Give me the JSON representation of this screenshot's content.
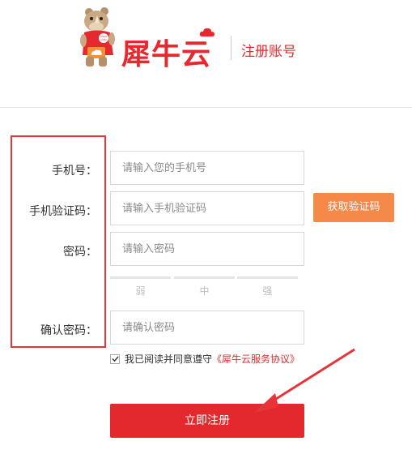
{
  "header": {
    "brand_name": "犀牛云",
    "page_title": "注册账号",
    "mascot_badge_text": "XINIU COM",
    "brand_color": "#e42a2f"
  },
  "form": {
    "phone": {
      "label": "手机号：",
      "placeholder": "请输入您的手机号"
    },
    "sms_code": {
      "label": "手机验证码：",
      "placeholder": "请输入手机验证码",
      "button": "获取验证码"
    },
    "password": {
      "label": "密码：",
      "placeholder": "请输入密码"
    },
    "strength": {
      "weak": "弱",
      "medium": "中",
      "strong": "强"
    },
    "confirm_password": {
      "label": "确认密码：",
      "placeholder": "请确认密码"
    }
  },
  "agreement": {
    "checked": true,
    "text": "我已阅读并同意遵守",
    "link_text": "《犀牛云服务协议》"
  },
  "submit": {
    "label": "立即注册"
  },
  "colors": {
    "accent": "#e3292e",
    "code_button": "#f5894a",
    "highlight_box": "#e73438"
  }
}
